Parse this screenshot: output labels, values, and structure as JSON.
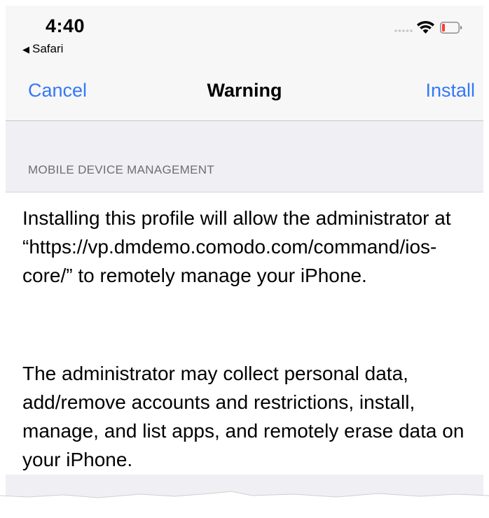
{
  "status_bar": {
    "time": "4:40",
    "back_app": "Safari",
    "icons": [
      "signal-dots-icon",
      "wifi-icon",
      "battery-icon"
    ],
    "battery_color": "#ff3b30"
  },
  "nav": {
    "cancel_label": "Cancel",
    "title": "Warning",
    "install_label": "Install",
    "accent_color": "#3478f6"
  },
  "section": {
    "header": "MOBILE DEVICE MANAGEMENT",
    "paragraphs": [
      "Installing this profile will allow the administrator at “https://vp.dmdemo.comodo.com/command/ios-core/” to remotely manage your iPhone.",
      "The administrator may collect personal data, add/remove accounts and restrictions, install, manage, and list apps, and remotely erase data on your iPhone."
    ]
  }
}
